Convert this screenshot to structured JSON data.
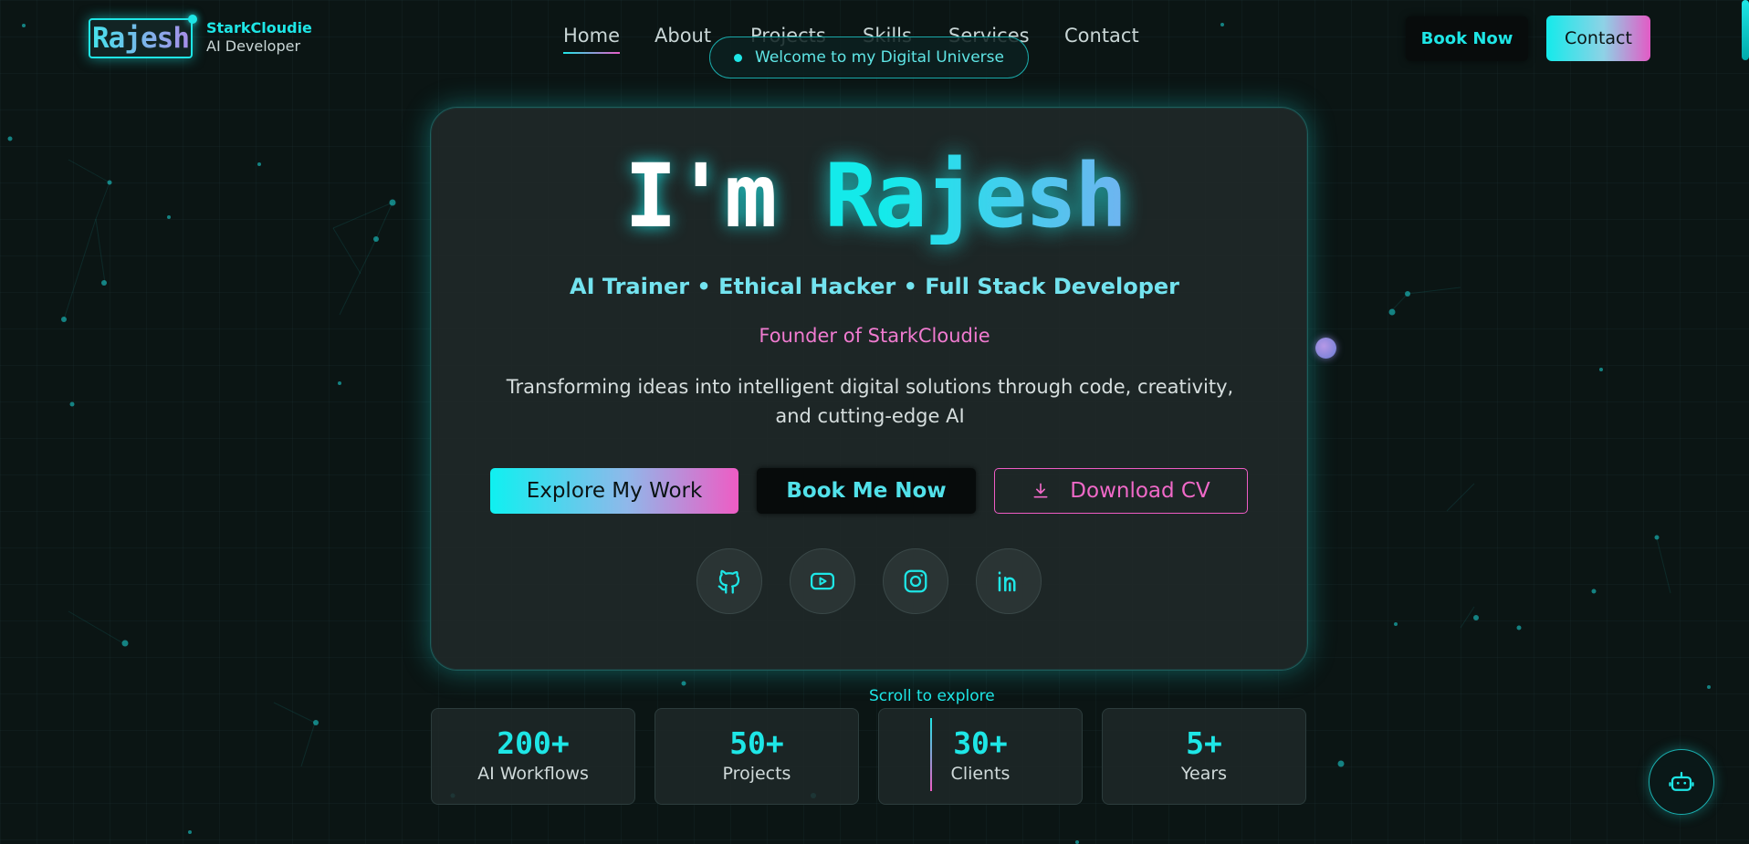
{
  "logo": {
    "text": "Rajesh",
    "brand_name": "StarkCloudie",
    "brand_role": "AI Developer"
  },
  "nav": {
    "items": [
      {
        "label": "Home",
        "active": true
      },
      {
        "label": "About"
      },
      {
        "label": "Projects"
      },
      {
        "label": "Skills"
      },
      {
        "label": "Services"
      },
      {
        "label": "Contact"
      }
    ]
  },
  "header": {
    "book_now": "Book Now",
    "contact": "Contact"
  },
  "welcome_pill": "Welcome to my Digital Universe",
  "hero": {
    "title_prefix": "I'm ",
    "title_name": "Rajesh",
    "roles": "AI Trainer • Ethical Hacker • Full Stack Developer",
    "founder": "Founder of StarkCloudie",
    "description": "Transforming ideas into intelligent digital solutions through code, creativity, and cutting-edge AI",
    "buttons": {
      "explore": "Explore My Work",
      "book": "Book Me Now",
      "cv": "Download CV"
    },
    "socials": [
      "github-icon",
      "youtube-icon",
      "instagram-icon",
      "linkedin-icon"
    ]
  },
  "scroll_hint": "Scroll to explore",
  "stats": [
    {
      "value": "200+",
      "label": "AI Workflows"
    },
    {
      "value": "50+",
      "label": "Projects"
    },
    {
      "value": "30+",
      "label": "Clients"
    },
    {
      "value": "5+",
      "label": "Years"
    }
  ],
  "colors": {
    "accent": "#1ee6e6",
    "pink": "#ee5cc4",
    "background": "#0b1514"
  }
}
